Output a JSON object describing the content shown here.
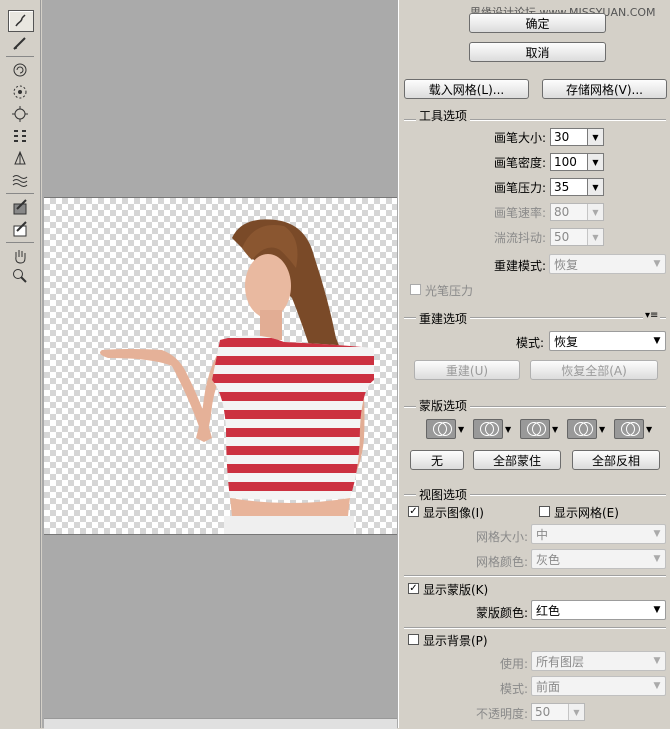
{
  "watermark": "思缘设计论坛  www.MISSYUAN.COM",
  "buttons": {
    "ok": "确定",
    "cancel": "取消",
    "load_mesh": "载入网格(L)...",
    "save_mesh": "存储网格(V)..."
  },
  "tool_options": {
    "title": "工具选项",
    "brush_size": {
      "label": "画笔大小:",
      "value": "30"
    },
    "brush_density": {
      "label": "画笔密度:",
      "value": "100"
    },
    "brush_pressure": {
      "label": "画笔压力:",
      "value": "35"
    },
    "brush_rate": {
      "label": "画笔速率:",
      "value": "80"
    },
    "turbulent_jitter": {
      "label": "湍流抖动:",
      "value": "50"
    },
    "reconstruct_mode": {
      "label": "重建模式:",
      "value": "恢复"
    },
    "stylus_pressure": "光笔压力"
  },
  "reconstruct_options": {
    "title": "重建选项",
    "mode_label": "模式:",
    "mode_value": "恢复",
    "reconstruct_btn": "重建(U)",
    "restore_all_btn": "恢复全部(A)"
  },
  "mask_options": {
    "title": "蒙版选项",
    "none": "无",
    "mask_all": "全部蒙住",
    "invert_all": "全部反相"
  },
  "view_options": {
    "title": "视图选项",
    "show_image": "显示图像(I)",
    "show_mesh": "显示网格(E)",
    "mesh_size_label": "网格大小:",
    "mesh_size_value": "中",
    "mesh_color_label": "网格颜色:",
    "mesh_color_value": "灰色",
    "show_mask": "显示蒙版(K)",
    "mask_color_label": "蒙版颜色:",
    "mask_color_value": "红色",
    "show_backdrop": "显示背景(P)",
    "use_label": "使用:",
    "use_value": "所有图层",
    "mode_label": "模式:",
    "mode_value": "前面",
    "opacity_label": "不透明度:",
    "opacity_value": "50"
  },
  "tools": [
    "forward-warp-icon",
    "reconstruct-icon",
    "twirl-icon",
    "pucker-icon",
    "bloat-icon",
    "push-left-icon",
    "mirror-icon",
    "turbulence-icon",
    "freeze-mask-icon",
    "thaw-mask-icon",
    "hand-icon",
    "zoom-icon"
  ]
}
